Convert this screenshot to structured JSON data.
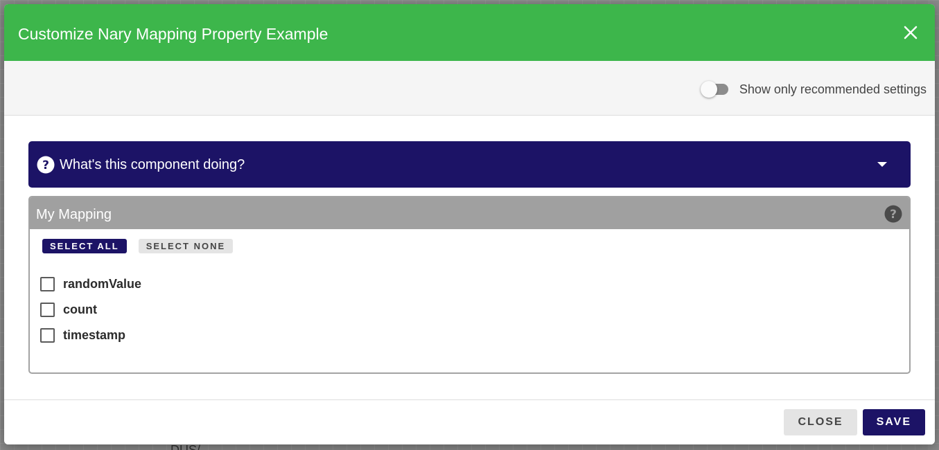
{
  "dialog": {
    "title": "Customize Nary Mapping Property Example",
    "close_icon": "close-icon"
  },
  "toolbar": {
    "toggle_label": "Show only recommended settings",
    "toggle_on": false
  },
  "accordion": {
    "title": "What's this component doing?",
    "icon": "question-circle-icon",
    "expanded": false
  },
  "mapping": {
    "title": "My Mapping",
    "help_icon": "help-icon",
    "select_all_label": "SELECT ALL",
    "select_none_label": "SELECT NONE",
    "items": [
      {
        "label": "randomValue",
        "checked": false
      },
      {
        "label": "count",
        "checked": false
      },
      {
        "label": "timestamp",
        "checked": false
      }
    ]
  },
  "footer": {
    "close_label": "CLOSE",
    "save_label": "SAVE"
  },
  "background": {
    "partial_text": "DUS/"
  },
  "colors": {
    "header_green": "#3db64b",
    "primary_navy": "#1c1366",
    "panel_header_gray": "#a0a0a0"
  }
}
